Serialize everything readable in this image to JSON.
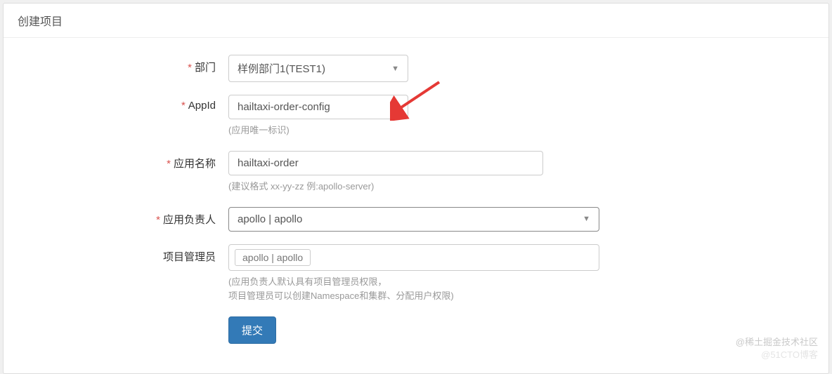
{
  "panel": {
    "title": "创建项目"
  },
  "form": {
    "department": {
      "label": "部门",
      "value": "样例部门1(TEST1)"
    },
    "appId": {
      "label": "AppId",
      "value": "hailtaxi-order-config",
      "help": "(应用唯一标识)"
    },
    "appName": {
      "label": "应用名称",
      "value": "hailtaxi-order",
      "help": "(建议格式 xx-yy-zz 例:apollo-server)"
    },
    "owner": {
      "label": "应用负责人",
      "value": "apollo | apollo"
    },
    "admins": {
      "label": "项目管理员",
      "tag": "apollo | apollo",
      "help1": "(应用负责人默认具有项目管理员权限，",
      "help2": "项目管理员可以创建Namespace和集群、分配用户权限)"
    },
    "submit": {
      "label": "提交"
    }
  },
  "watermark": {
    "line1": "@稀土掘金技术社区",
    "line2": "@51CTO博客"
  }
}
